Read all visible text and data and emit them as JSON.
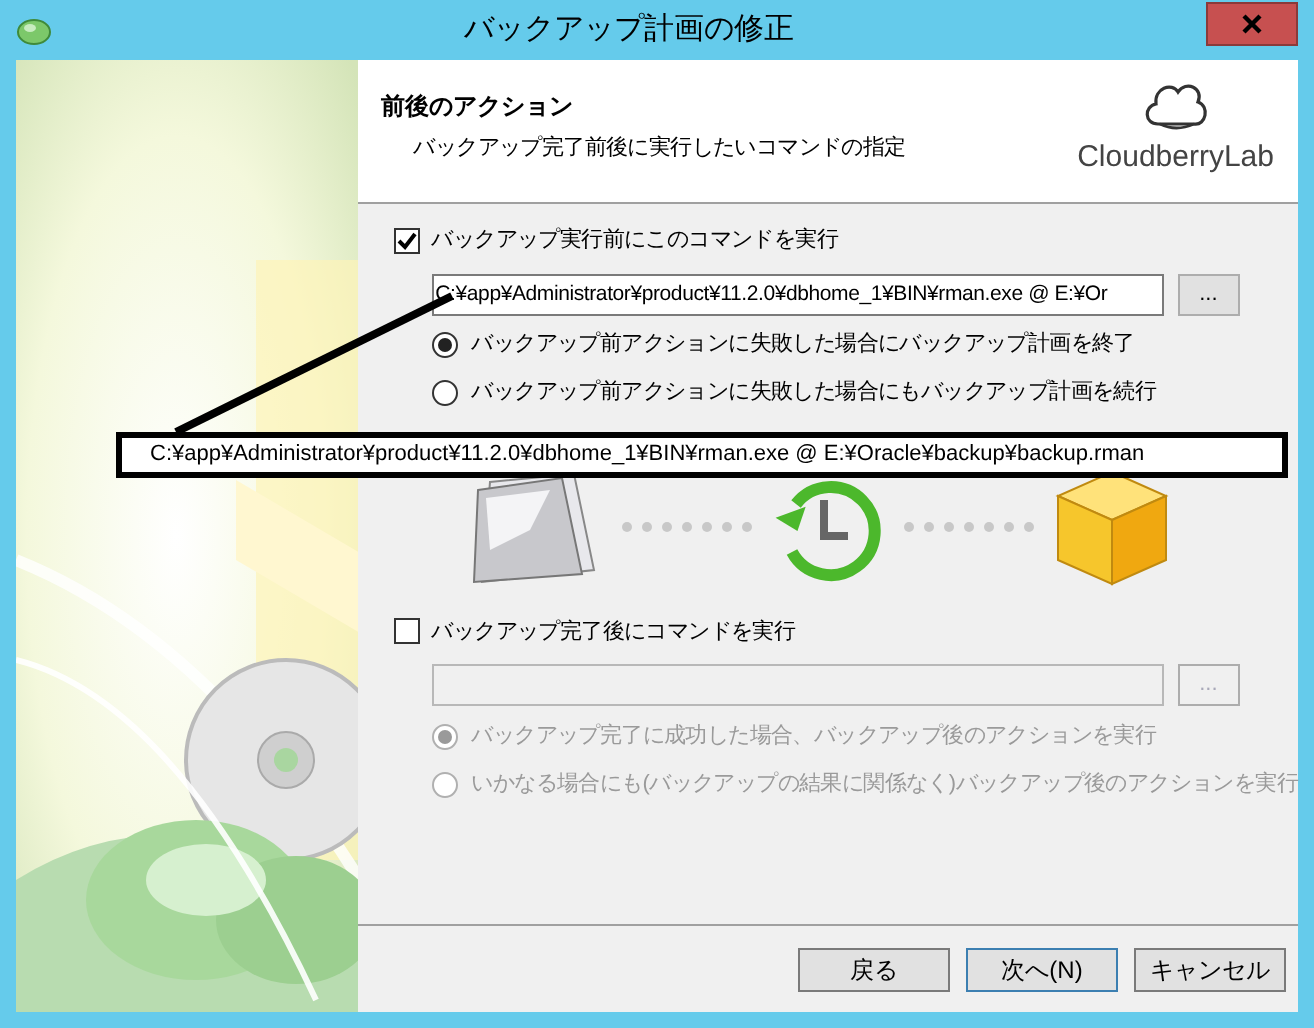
{
  "window": {
    "title": "バックアップ計画の修正"
  },
  "header": {
    "title": "前後のアクション",
    "subtitle": "バックアップ完了前後に実行したいコマンドの指定",
    "logo": "CloudberryLab"
  },
  "pre_action": {
    "label": "バックアップ実行前にこのコマンドを実行",
    "checked": true,
    "disabled": false,
    "command": "C:¥app¥Administrator¥product¥11.2.0¥dbhome_1¥BIN¥rman.exe @ E:¥Or",
    "browse": "...",
    "options": [
      {
        "label": "バックアップ前アクションに失敗した場合にバックアップ計画を終了",
        "selected": true
      },
      {
        "label": "バックアップ前アクションに失敗した場合にもバックアップ計画を続行",
        "selected": false
      }
    ]
  },
  "callout": {
    "text": "C:¥app¥Administrator¥product¥11.2.0¥dbhome_1¥BIN¥rman.exe @ E:¥Oracle¥backup¥backup.rman"
  },
  "post_action": {
    "label": "バックアップ完了後にコマンドを実行",
    "checked": false,
    "disabled": true,
    "browse": "...",
    "options": [
      {
        "label": "バックアップ完了に成功した場合、バックアップ後のアクションを実行",
        "selected": true
      },
      {
        "label": "いかなる場合にも(バックアップの結果に関係なく)バックアップ後のアクションを実行",
        "selected": false
      }
    ]
  },
  "buttons": [
    {
      "label": "戻る",
      "default": false
    },
    {
      "label": "次へ(N)",
      "default": true
    },
    {
      "label": "キャンセル",
      "default": false
    }
  ]
}
